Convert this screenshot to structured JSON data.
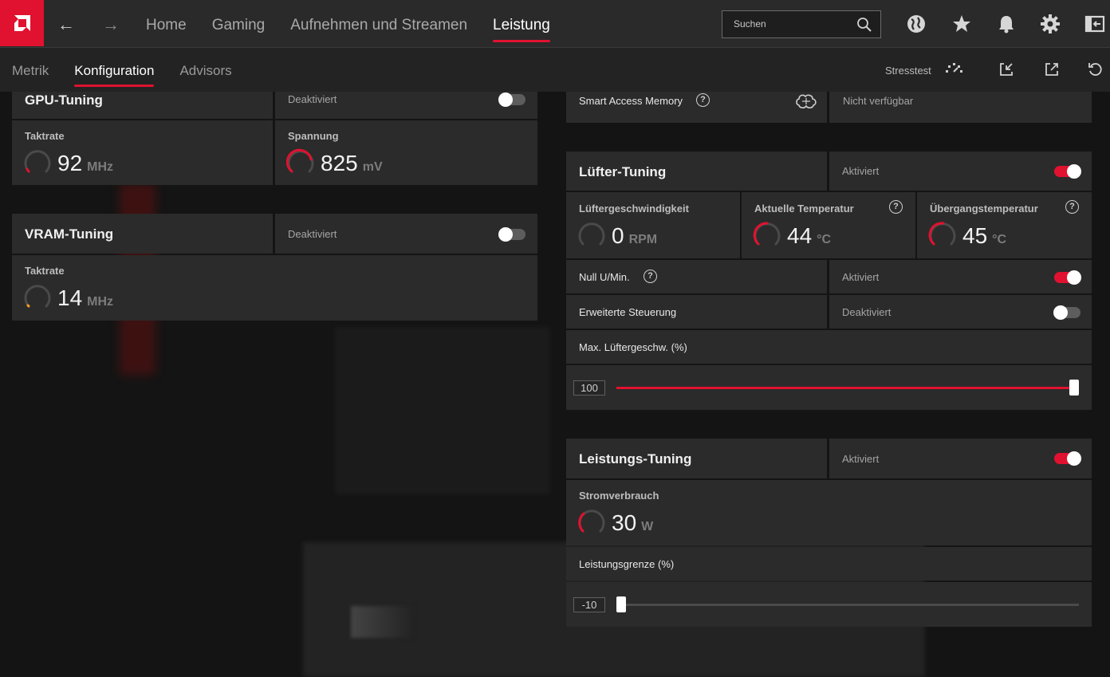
{
  "topbar": {
    "nav": [
      "Home",
      "Gaming",
      "Aufnehmen und Streamen",
      "Leistung"
    ],
    "active_nav": "Leistung",
    "search_placeholder": "Suchen"
  },
  "subnav": {
    "tabs": [
      "Metrik",
      "Konfiguration",
      "Advisors"
    ],
    "active_tab": "Konfiguration",
    "stresstest_label": "Stresstest"
  },
  "colors": {
    "accent": "#e0122f",
    "panel": "#282828",
    "background": "#141414"
  },
  "gpu_tuning": {
    "title": "GPU-Tuning",
    "status": "Deaktiviert",
    "enabled": false,
    "clock": {
      "label": "Taktrate",
      "value": "92",
      "unit": "MHz",
      "level": 0.05
    },
    "voltage": {
      "label": "Spannung",
      "value": "825",
      "unit": "mV",
      "level": 0.65
    }
  },
  "vram_tuning": {
    "title": "VRAM-Tuning",
    "status": "Deaktiviert",
    "enabled": false,
    "clock": {
      "label": "Taktrate",
      "value": "14",
      "unit": "MHz",
      "level": 0.02
    }
  },
  "smart_access_memory": {
    "label": "Smart Access Memory",
    "status": "Nicht verfügbar"
  },
  "fan_tuning": {
    "title": "Lüfter-Tuning",
    "status": "Aktiviert",
    "enabled": true,
    "fan_speed": {
      "label": "Lüftergeschwindigkeit",
      "value": "0",
      "unit": "RPM",
      "level": 0
    },
    "current_temp": {
      "label": "Aktuelle Temperatur",
      "value": "44",
      "unit": "°C",
      "level": 0.5
    },
    "junction_temp": {
      "label": "Übergangstemperatur",
      "value": "45",
      "unit": "°C",
      "level": 0.5
    },
    "zero_rpm": {
      "label": "Null U/Min.",
      "status": "Aktiviert",
      "enabled": true
    },
    "advanced_control": {
      "label": "Erweiterte Steuerung",
      "status": "Deaktiviert",
      "enabled": false
    },
    "max_fan_speed": {
      "label": "Max. Lüftergeschw. (%)",
      "value": "100",
      "fraction": 1.0
    }
  },
  "power_tuning": {
    "title": "Leistungs-Tuning",
    "status": "Aktiviert",
    "enabled": true,
    "power_draw": {
      "label": "Stromverbrauch",
      "value": "30",
      "unit": "W",
      "level": 0.35
    },
    "power_limit": {
      "label": "Leistungsgrenze (%)",
      "value": "-10",
      "fraction": 0.0
    }
  }
}
